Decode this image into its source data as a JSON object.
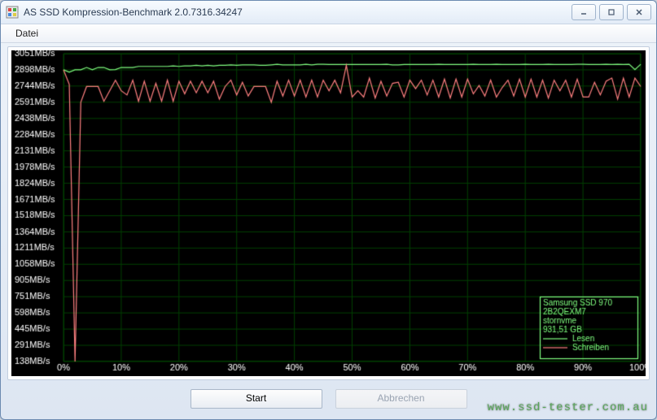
{
  "window": {
    "title": "AS SSD Kompression-Benchmark 2.0.7316.34247"
  },
  "menu": {
    "file": "Datei"
  },
  "buttons": {
    "start": "Start",
    "abort": "Abbrechen"
  },
  "info_box": {
    "line1": "Samsung SSD 970",
    "line2": "2B2QEXM7",
    "line3": "stornvme",
    "line4": "931,51 GB"
  },
  "legend": {
    "read": "Lesen",
    "write": "Schreiben"
  },
  "colors": {
    "bg": "#000000",
    "grid": "#004000",
    "read": "#80ff80",
    "write": "#ff8080",
    "axis_text": "#ffffff",
    "info_text": "#80ff80"
  },
  "watermark": "www.ssd-tester.com.au",
  "chart_data": {
    "type": "line",
    "xlabel": "",
    "ylabel": "",
    "x_ticks": [
      "0%",
      "10%",
      "20%",
      "30%",
      "40%",
      "50%",
      "60%",
      "70%",
      "80%",
      "90%",
      "100%"
    ],
    "y_ticks": [
      "138MB/s",
      "291MB/s",
      "445MB/s",
      "598MB/s",
      "751MB/s",
      "905MB/s",
      "1058MB/s",
      "1211MB/s",
      "1364MB/s",
      "1518MB/s",
      "1671MB/s",
      "1824MB/s",
      "1978MB/s",
      "2131MB/s",
      "2284MB/s",
      "2438MB/s",
      "2591MB/s",
      "2744MB/s",
      "2898MB/s",
      "3051MB/s"
    ],
    "ylim": [
      138,
      3051
    ],
    "xlim": [
      0,
      100
    ],
    "series": [
      {
        "name": "Lesen",
        "color": "#80ff80",
        "x": [
          0,
          1,
          2,
          3,
          4,
          5,
          6,
          7,
          8,
          9,
          10,
          11,
          12,
          13,
          14,
          15,
          16,
          17,
          18,
          19,
          20,
          21,
          22,
          23,
          24,
          25,
          26,
          27,
          28,
          29,
          30,
          31,
          32,
          33,
          34,
          35,
          36,
          37,
          38,
          39,
          40,
          41,
          42,
          43,
          44,
          45,
          46,
          47,
          48,
          49,
          50,
          51,
          52,
          53,
          54,
          55,
          56,
          57,
          58,
          59,
          60,
          61,
          62,
          63,
          64,
          65,
          66,
          67,
          68,
          69,
          70,
          71,
          72,
          73,
          74,
          75,
          76,
          77,
          78,
          79,
          80,
          81,
          82,
          83,
          84,
          85,
          86,
          87,
          88,
          89,
          90,
          91,
          92,
          93,
          94,
          95,
          96,
          97,
          98,
          99,
          100
        ],
        "y": [
          2898,
          2875,
          2898,
          2898,
          2920,
          2898,
          2920,
          2920,
          2898,
          2900,
          2920,
          2920,
          2920,
          2930,
          2930,
          2930,
          2930,
          2930,
          2930,
          2935,
          2930,
          2935,
          2935,
          2940,
          2935,
          2940,
          2935,
          2940,
          2940,
          2945,
          2940,
          2945,
          2945,
          2945,
          2940,
          2940,
          2945,
          2950,
          2945,
          2945,
          2945,
          2945,
          2950,
          2945,
          2950,
          2950,
          2948,
          2948,
          2948,
          2948,
          2948,
          2948,
          2948,
          2948,
          2948,
          2948,
          2950,
          2945,
          2945,
          2948,
          2948,
          2948,
          2948,
          2948,
          2948,
          2950,
          2948,
          2948,
          2948,
          2948,
          2948,
          2950,
          2948,
          2948,
          2948,
          2950,
          2948,
          2948,
          2948,
          2948,
          2950,
          2948,
          2948,
          2948,
          2950,
          2948,
          2948,
          2948,
          2948,
          2950,
          2950,
          2948,
          2948,
          2948,
          2950,
          2948,
          2950,
          2948,
          2950,
          2900,
          2950
        ]
      },
      {
        "name": "Schreiben",
        "color": "#ff8080",
        "x": [
          0,
          1,
          2,
          3,
          4,
          5,
          6,
          7,
          8,
          9,
          10,
          11,
          12,
          13,
          14,
          15,
          16,
          17,
          18,
          19,
          20,
          21,
          22,
          23,
          24,
          25,
          26,
          27,
          28,
          29,
          30,
          31,
          32,
          33,
          34,
          35,
          36,
          37,
          38,
          39,
          40,
          41,
          42,
          43,
          44,
          45,
          46,
          47,
          48,
          49,
          50,
          51,
          52,
          53,
          54,
          55,
          56,
          57,
          58,
          59,
          60,
          61,
          62,
          63,
          64,
          65,
          66,
          67,
          68,
          69,
          70,
          71,
          72,
          73,
          74,
          75,
          76,
          77,
          78,
          79,
          80,
          81,
          82,
          83,
          84,
          85,
          86,
          87,
          88,
          89,
          90,
          91,
          92,
          93,
          94,
          95,
          96,
          97,
          98,
          99,
          100
        ],
        "y": [
          2898,
          2760,
          138,
          2591,
          2740,
          2740,
          2740,
          2600,
          2700,
          2800,
          2700,
          2660,
          2800,
          2600,
          2790,
          2600,
          2770,
          2600,
          2800,
          2600,
          2790,
          2670,
          2790,
          2680,
          2790,
          2680,
          2790,
          2620,
          2740,
          2800,
          2660,
          2780,
          2650,
          2740,
          2740,
          2740,
          2590,
          2790,
          2650,
          2800,
          2650,
          2800,
          2640,
          2800,
          2640,
          2800,
          2700,
          2800,
          2680,
          2940,
          2640,
          2700,
          2640,
          2820,
          2630,
          2790,
          2650,
          2770,
          2780,
          2640,
          2800,
          2720,
          2800,
          2660,
          2800,
          2640,
          2810,
          2630,
          2810,
          2640,
          2810,
          2670,
          2750,
          2650,
          2800,
          2640,
          2730,
          2800,
          2650,
          2810,
          2640,
          2810,
          2640,
          2800,
          2630,
          2800,
          2700,
          2800,
          2640,
          2810,
          2640,
          2640,
          2780,
          2660,
          2790,
          2820,
          2620,
          2820,
          2640,
          2820,
          2740
        ]
      }
    ]
  }
}
